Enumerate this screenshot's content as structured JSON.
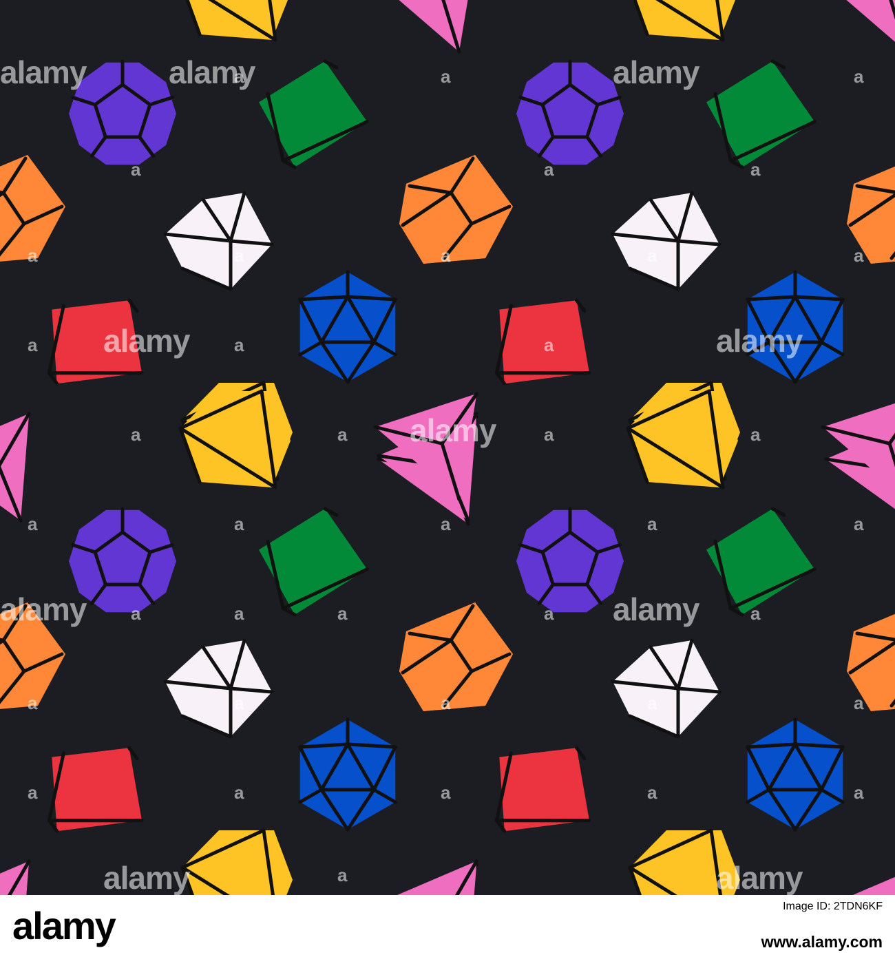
{
  "palette": {
    "background": "#1b1d22",
    "outline": "#111111",
    "d4": "#f06ec0",
    "d6_green": "#028a38",
    "d6_red": "#eb3440",
    "d8": "#fec324",
    "d10": "#ff8838",
    "d12": "#6236d2",
    "d20": "#0650cc",
    "d8_white": "#f8f2f8"
  },
  "dice_kinds": [
    "d4-pyramid",
    "d6-cube-green",
    "d6-cube-red",
    "d8-octahedron",
    "d10-pentagonal",
    "d12-dodecahedron",
    "d20-icosahedron",
    "white-gem"
  ],
  "watermark": {
    "word": "alamy",
    "letter": "a"
  },
  "footer": {
    "brand": "alamy",
    "image_id": "Image ID: 2TDN6KF",
    "url": "www.alamy.com"
  }
}
